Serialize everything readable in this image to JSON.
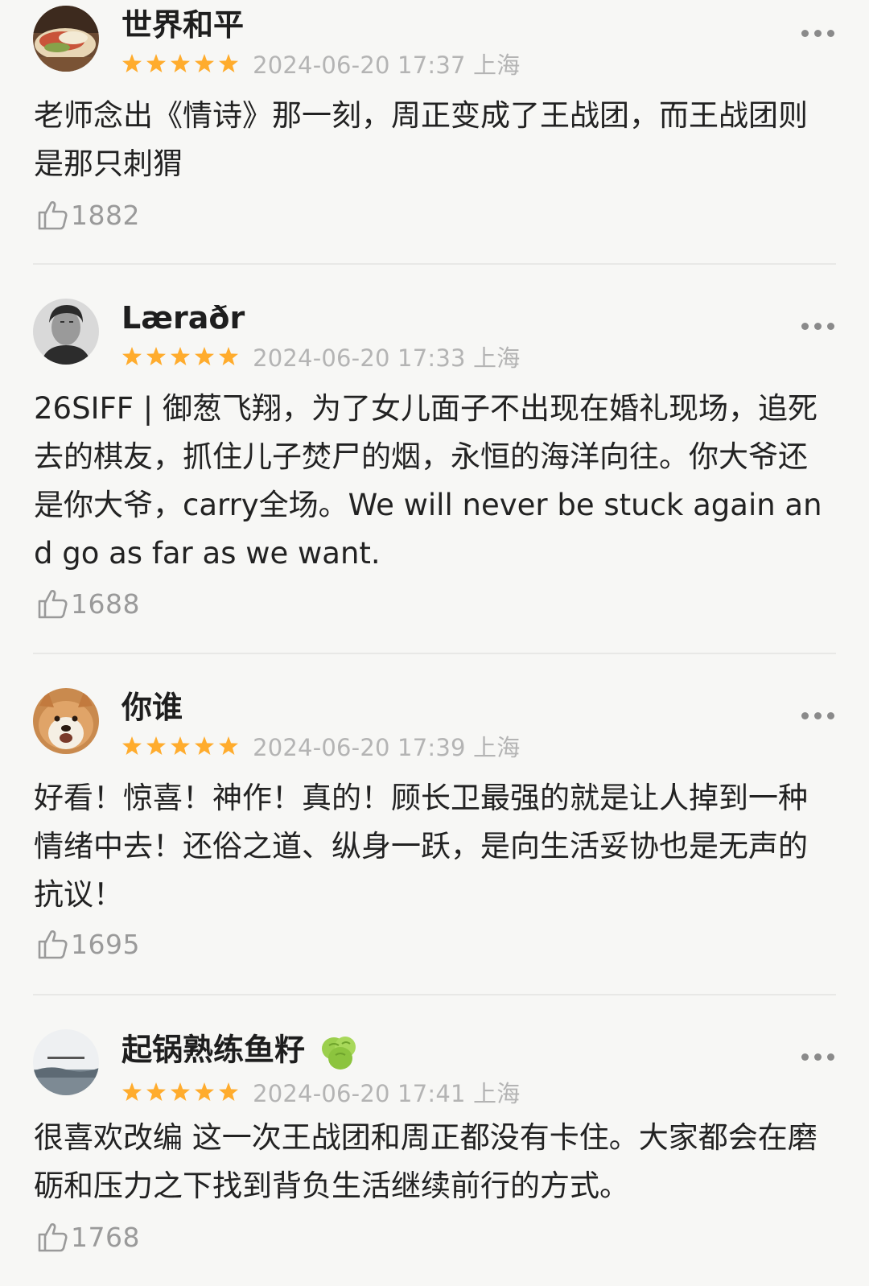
{
  "reviews": [
    {
      "username": "世界和平",
      "rating": 5,
      "timestamp": "2024-06-20 17:37 上海",
      "text": "老师念出《情诗》那一刻，周正变成了王战团，而王战团则是那只刺猬",
      "likes": "1882"
    },
    {
      "username": "Læraðr",
      "rating": 5,
      "timestamp": "2024-06-20 17:33 上海",
      "text": "26SIFF | 御葱飞翔，为了女儿面子不出现在婚礼现场，追死去的棋友，抓住儿子焚尸的烟，永恒的海洋向往。你大爷还是你大爷，carry全场。We will never be stuck again and go as far as we want.",
      "likes": "1688"
    },
    {
      "username": "你谁",
      "rating": 5,
      "timestamp": "2024-06-20 17:39 上海",
      "text": "好看！惊喜！神作！真的！顾长卫最强的就是让人掉到一种情绪中去！还俗之道、纵身一跃，是向生活妥协也是无声的抗议！",
      "likes": "1695"
    },
    {
      "username": "起锅熟练鱼籽",
      "rating": 5,
      "timestamp": "2024-06-20 17:41 上海",
      "text": "很喜欢改编 这一次王战团和周正都没有卡住。大家都会在磨砺和压力之下找到背负生活继续前行的方式。",
      "likes": "1768"
    }
  ],
  "colors": {
    "star": "#ffac2d",
    "background": "#f7f7f5",
    "muted_text": "#b4b4b4",
    "like_count": "#9a9a9a"
  },
  "icons": {
    "more": "more-dots-icon",
    "like": "thumbs-up-icon",
    "star": "star-icon",
    "badge": "green-hop-badge-icon"
  }
}
